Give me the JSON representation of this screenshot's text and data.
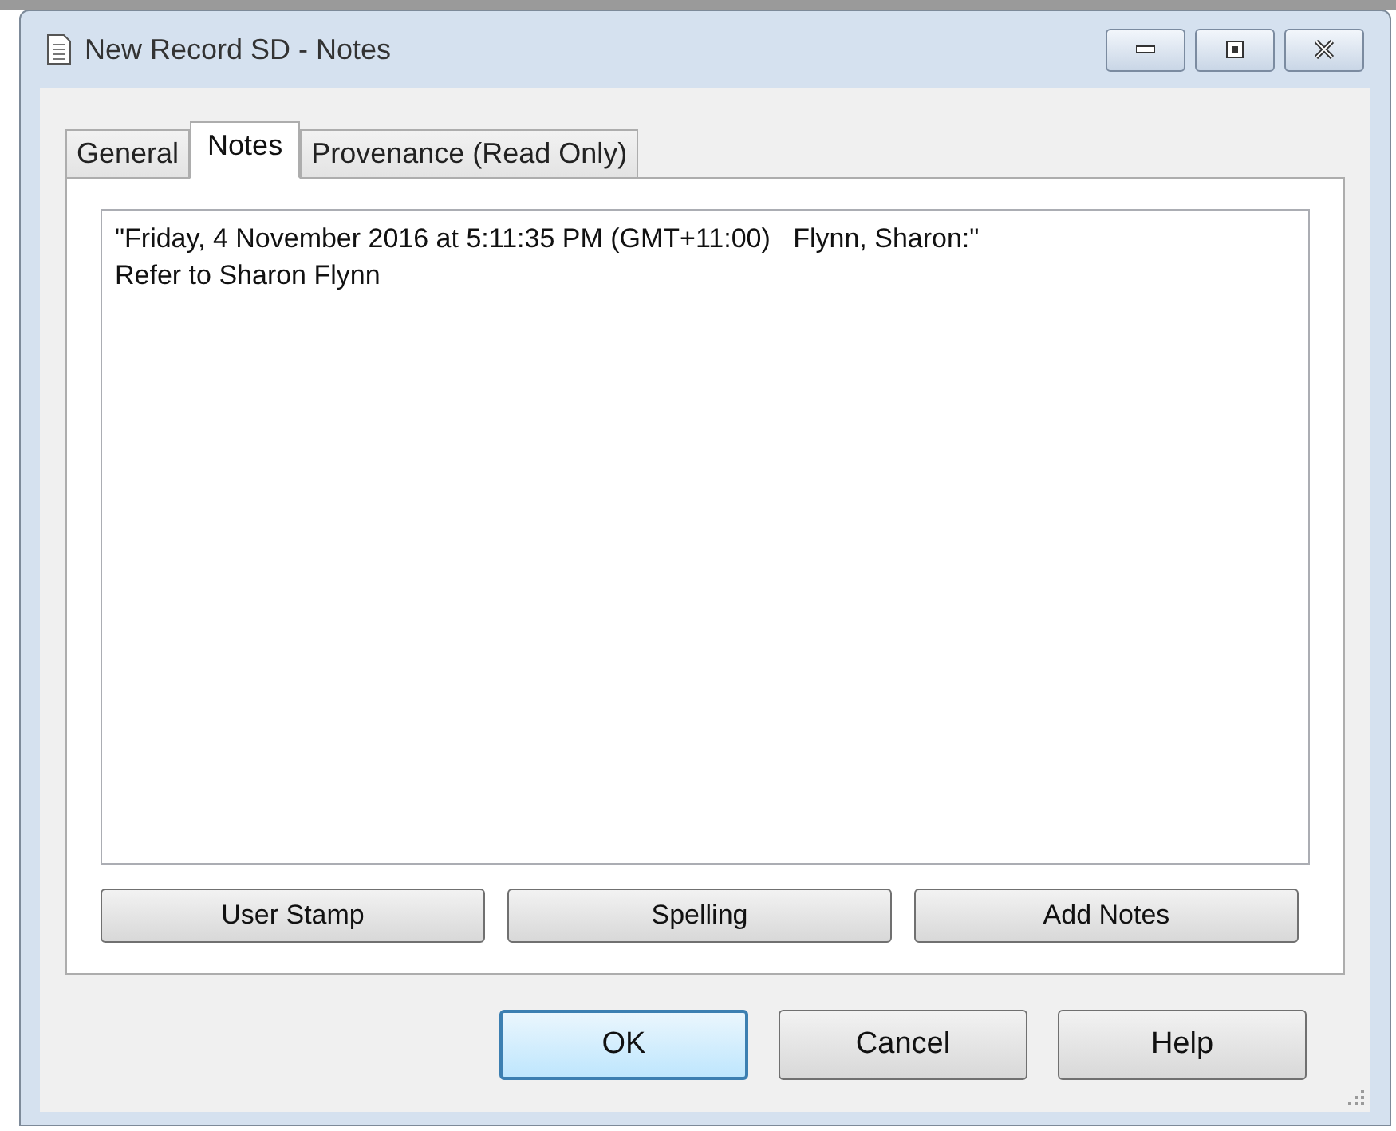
{
  "window": {
    "title": "New Record SD - Notes"
  },
  "tabs": [
    {
      "label": "General",
      "selected": false
    },
    {
      "label": "Notes",
      "selected": true
    },
    {
      "label": "Provenance (Read Only)",
      "selected": false
    }
  ],
  "notes": {
    "lines": [
      "\"Friday, 4 November 2016 at 5:11:35 PM (GMT+11:00)   Flynn, Sharon:\"",
      "Refer to Sharon Flynn"
    ]
  },
  "note_buttons": [
    "User Stamp",
    "Spelling",
    "Add Notes"
  ],
  "dialog_buttons": [
    {
      "label": "OK",
      "default": true
    },
    {
      "label": "Cancel",
      "default": false
    },
    {
      "label": "Help",
      "default": false
    }
  ]
}
